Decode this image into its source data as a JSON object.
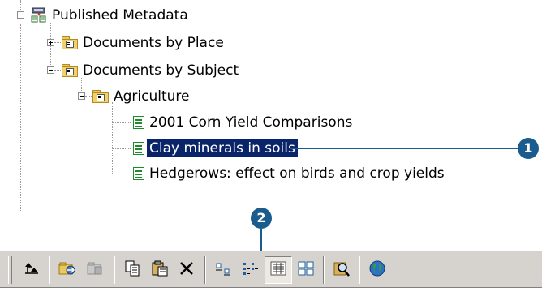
{
  "tree": {
    "root": {
      "label": "Published Metadata",
      "icon": "published-metadata-icon"
    },
    "folders": [
      {
        "label": "Documents by Place",
        "expanded": false
      },
      {
        "label": "Documents by Subject",
        "expanded": true
      }
    ],
    "subfolder": {
      "label": "Agriculture",
      "expanded": true
    },
    "documents": [
      {
        "label": "2001 Corn Yield Comparisons",
        "selected": false
      },
      {
        "label": "Clay minerals in soils",
        "selected": true
      },
      {
        "label": "Hedgerows: effect on birds and crop yields",
        "selected": false
      }
    ]
  },
  "callouts": [
    "1",
    "2"
  ],
  "toolbar": {
    "buttons": [
      "up-one-level",
      "connect",
      "disconnect",
      "copy",
      "paste",
      "delete",
      "large-icons",
      "list",
      "details",
      "thumbnails",
      "search",
      "launch-arcmap"
    ],
    "pressed": "details"
  },
  "colors": {
    "selection": "#0a246a",
    "callout": "#1a5c8e",
    "toolbar": "#d6d3ce"
  }
}
